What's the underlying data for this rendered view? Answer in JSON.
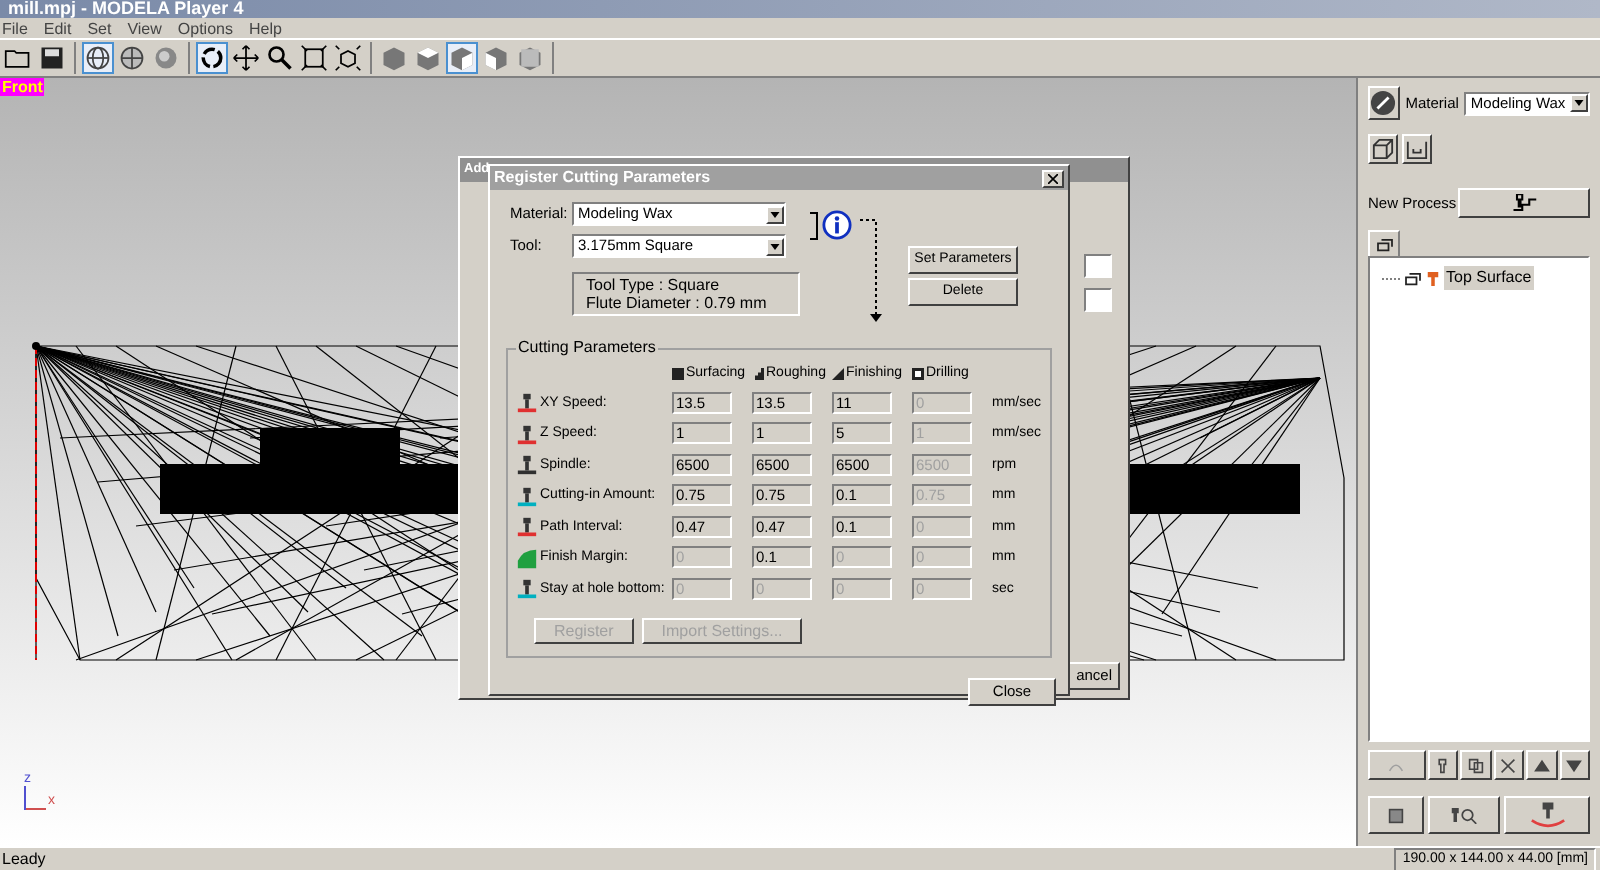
{
  "window": {
    "title": "mill.mpj - MODELA Player 4"
  },
  "menu": [
    "File",
    "Edit",
    "Set",
    "View",
    "Options",
    "Help"
  ],
  "toolbar": [
    [
      {
        "selected": false
      },
      {
        "selected": false
      }
    ],
    [
      {
        "selected": true
      },
      {
        "selected": false
      },
      {
        "selected": false
      }
    ],
    [
      {
        "selected": true
      },
      {
        "selected": false
      },
      {
        "selected": false
      },
      {
        "selected": false
      },
      {
        "selected": false
      }
    ],
    [
      {
        "selected": false
      },
      {
        "selected": false
      },
      {
        "selected": true
      },
      {
        "selected": false
      },
      {
        "selected": false
      }
    ]
  ],
  "viewport": {
    "view_label": "Front",
    "axis_labels": [
      "z",
      "x"
    ]
  },
  "back_dialog": {
    "title": "Add",
    "button": "ancel"
  },
  "dialog": {
    "title": "Register Cutting Parameters",
    "material_label": "Material:",
    "material": "Modeling Wax",
    "tool_label": "Tool:",
    "tool": "3.175mm Square",
    "tool_info": [
      "Tool Type : Square",
      "Flute Diameter : 0.79 mm"
    ],
    "buttons": [
      {
        "label": "Set Parameters",
        "disabled": false
      },
      {
        "label": "Delete",
        "disabled": false
      }
    ],
    "group_title": "Cutting Parameters",
    "columns": [
      "Surfacing",
      "Roughing",
      "Finishing",
      "Drilling"
    ],
    "rows": [
      {
        "label": "XY Speed:",
        "unit": "mm/sec",
        "cells": [
          {
            "value": "13.5",
            "disabled": false
          },
          {
            "value": "13.5",
            "disabled": false
          },
          {
            "value": "11",
            "disabled": false
          },
          {
            "value": "0",
            "disabled": true
          }
        ]
      },
      {
        "label": "Z Speed:",
        "unit": "mm/sec",
        "cells": [
          {
            "value": "1",
            "disabled": false
          },
          {
            "value": "1",
            "disabled": false
          },
          {
            "value": "5",
            "disabled": false
          },
          {
            "value": "1",
            "disabled": true
          }
        ]
      },
      {
        "label": "Spindle:",
        "unit": "rpm",
        "cells": [
          {
            "value": "6500",
            "disabled": false
          },
          {
            "value": "6500",
            "disabled": false
          },
          {
            "value": "6500",
            "disabled": false
          },
          {
            "value": "6500",
            "disabled": true
          }
        ]
      },
      {
        "label": "Cutting-in Amount:",
        "unit": "mm",
        "cells": [
          {
            "value": "0.75",
            "disabled": false
          },
          {
            "value": "0.75",
            "disabled": false
          },
          {
            "value": "0.1",
            "disabled": false
          },
          {
            "value": "0.75",
            "disabled": true
          }
        ]
      },
      {
        "label": "Path Interval:",
        "unit": "mm",
        "cells": [
          {
            "value": "0.47",
            "disabled": false
          },
          {
            "value": "0.47",
            "disabled": false
          },
          {
            "value": "0.1",
            "disabled": false
          },
          {
            "value": "0",
            "disabled": true
          }
        ]
      },
      {
        "label": "Finish Margin:",
        "unit": "mm",
        "cells": [
          {
            "value": "0",
            "disabled": true
          },
          {
            "value": "0.1",
            "disabled": false
          },
          {
            "value": "0",
            "disabled": true
          },
          {
            "value": "0",
            "disabled": true
          }
        ]
      },
      {
        "label": "Stay at hole bottom:",
        "unit": "sec",
        "cells": [
          {
            "value": "0",
            "disabled": true
          },
          {
            "value": "0",
            "disabled": true
          },
          {
            "value": "0",
            "disabled": true
          },
          {
            "value": "0",
            "disabled": true
          }
        ]
      }
    ],
    "footer_buttons": [
      {
        "label": "Register",
        "disabled": true
      },
      {
        "label": "Import Settings...",
        "disabled": true
      }
    ],
    "close": "Close"
  },
  "side_panel": {
    "material_label": "Material",
    "material": "Modeling Wax",
    "new_process_label": "New Process",
    "tree": [
      {
        "label": "Top Surface",
        "selected": true
      }
    ],
    "list_buttons": [
      {
        "disabled": true
      },
      {
        "disabled": false
      },
      {
        "disabled": false
      },
      {
        "disabled": false
      },
      {
        "disabled": false
      },
      {
        "disabled": false
      }
    ]
  },
  "status_bar": {
    "message": "Leady",
    "dimensions": "190.00 x 144.00 x 44.00 [mm]"
  }
}
